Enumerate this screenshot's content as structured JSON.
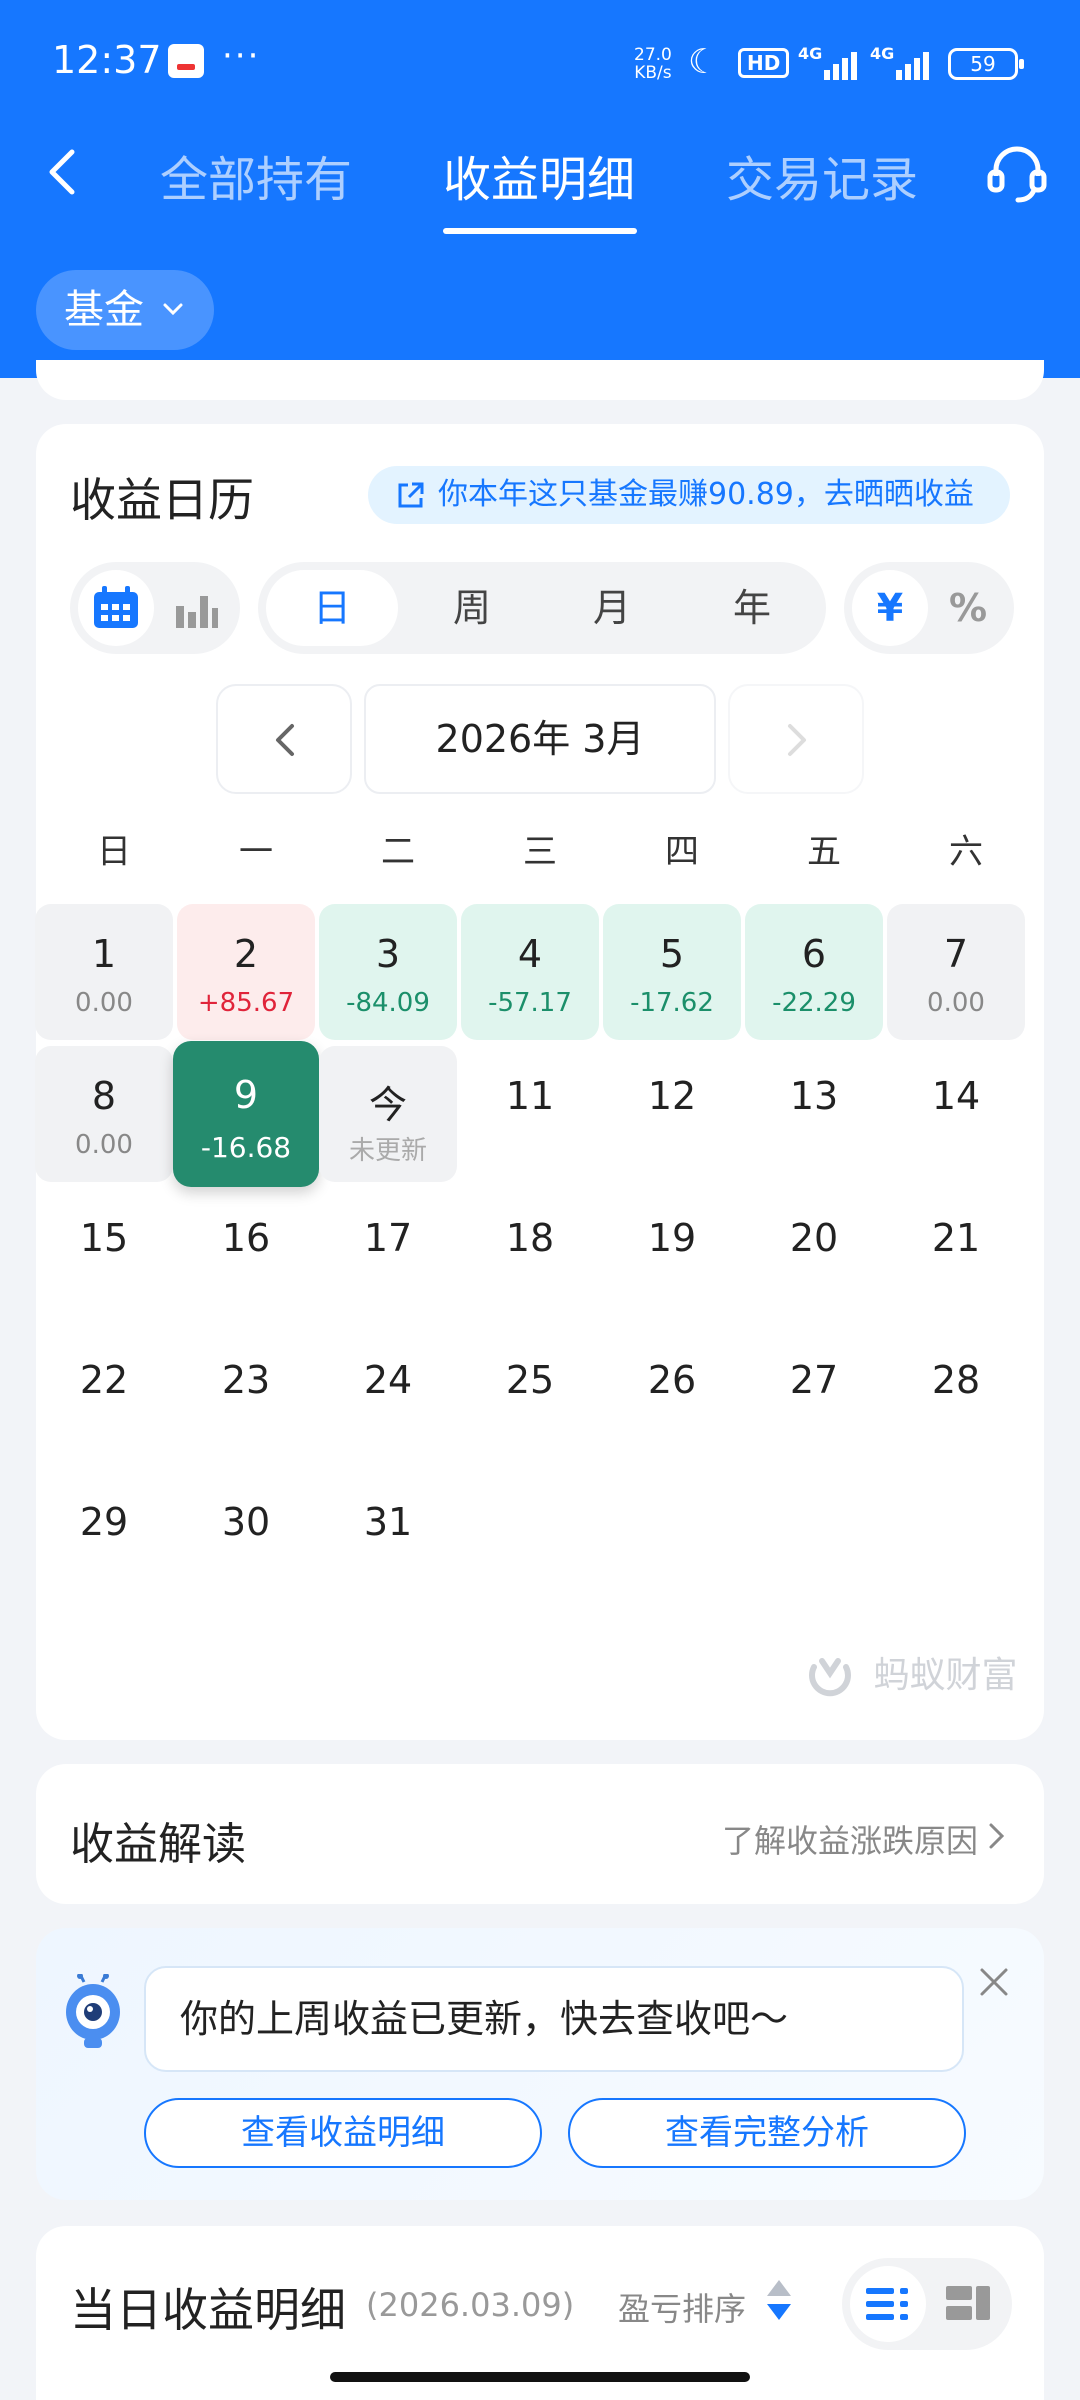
{
  "status_bar": {
    "time": "12:37",
    "more": "···",
    "net_speed_value": "27.0",
    "net_speed_unit": "KB/s",
    "hd": "HD",
    "signal1": "4G",
    "signal2": "4G",
    "battery": "59"
  },
  "nav": {
    "tabs": [
      "全部持有",
      "收益明细",
      "交易记录"
    ],
    "active_tab": "收益明细"
  },
  "filter": {
    "fund_label": "基金"
  },
  "calendar_card": {
    "title": "收益日历",
    "promo": "你本年这只基金最赚90.89，去晒晒收益",
    "periods": [
      "日",
      "周",
      "月",
      "年"
    ],
    "active_period": "日",
    "units": [
      "¥",
      "%"
    ],
    "active_unit": "¥",
    "month": "2026年 3月",
    "weekdays": [
      "日",
      "一",
      "二",
      "三",
      "四",
      "五",
      "六"
    ],
    "days": [
      {
        "day": "1",
        "value": "0.00",
        "state": "flat"
      },
      {
        "day": "2",
        "value": "+85.67",
        "state": "gain"
      },
      {
        "day": "3",
        "value": "-84.09",
        "state": "loss"
      },
      {
        "day": "4",
        "value": "-57.17",
        "state": "loss"
      },
      {
        "day": "5",
        "value": "-17.62",
        "state": "loss"
      },
      {
        "day": "6",
        "value": "-22.29",
        "state": "loss"
      },
      {
        "day": "7",
        "value": "0.00",
        "state": "flat"
      },
      {
        "day": "8",
        "value": "0.00",
        "state": "flat"
      },
      {
        "day": "9",
        "value": "-16.68",
        "state": "selected"
      },
      {
        "day": "今",
        "value": "未更新",
        "state": "today"
      },
      {
        "day": "11",
        "value": "",
        "state": "future"
      },
      {
        "day": "12",
        "value": "",
        "state": "future"
      },
      {
        "day": "13",
        "value": "",
        "state": "future"
      },
      {
        "day": "14",
        "value": "",
        "state": "future"
      },
      {
        "day": "15",
        "value": "",
        "state": "future"
      },
      {
        "day": "16",
        "value": "",
        "state": "future"
      },
      {
        "day": "17",
        "value": "",
        "state": "future"
      },
      {
        "day": "18",
        "value": "",
        "state": "future"
      },
      {
        "day": "19",
        "value": "",
        "state": "future"
      },
      {
        "day": "20",
        "value": "",
        "state": "future"
      },
      {
        "day": "21",
        "value": "",
        "state": "future"
      },
      {
        "day": "22",
        "value": "",
        "state": "future"
      },
      {
        "day": "23",
        "value": "",
        "state": "future"
      },
      {
        "day": "24",
        "value": "",
        "state": "future"
      },
      {
        "day": "25",
        "value": "",
        "state": "future"
      },
      {
        "day": "26",
        "value": "",
        "state": "future"
      },
      {
        "day": "27",
        "value": "",
        "state": "future"
      },
      {
        "day": "28",
        "value": "",
        "state": "future"
      },
      {
        "day": "29",
        "value": "",
        "state": "future"
      },
      {
        "day": "30",
        "value": "",
        "state": "future"
      },
      {
        "day": "31",
        "value": "",
        "state": "future"
      }
    ],
    "watermark": "蚂蚁财富"
  },
  "interpretation": {
    "title": "收益解读",
    "link": "了解收益涨跌原因"
  },
  "message": {
    "text": "你的上周收益已更新，快去查收吧～",
    "button_detail": "查看收益明细",
    "button_analysis": "查看完整分析"
  },
  "daily_detail": {
    "title": "当日收益明细",
    "date": "(2026.03.09)",
    "sort_label": "盈亏排序"
  },
  "colors": {
    "brand_blue": "#1677ff",
    "gain_red": "#e0243a",
    "loss_green": "#1b8f6a",
    "selected_green": "#258b6e"
  }
}
